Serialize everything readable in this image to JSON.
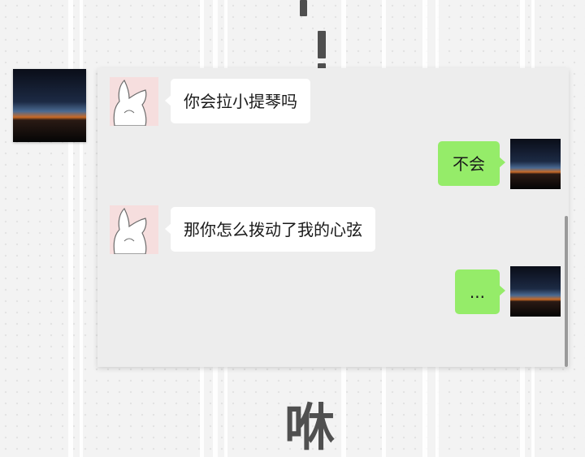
{
  "sound_effect": "咻",
  "messages": [
    {
      "side": "left",
      "text": "你会拉小提琴吗"
    },
    {
      "side": "right",
      "text": "不会"
    },
    {
      "side": "left",
      "text": "那你怎么拨动了我的心弦"
    },
    {
      "side": "right",
      "text": "..."
    }
  ],
  "colors": {
    "sent_bubble": "#95ec69",
    "received_bubble": "#ffffff",
    "chat_background": "#ededed"
  },
  "icons": {
    "contact_avatar": "bunny-sketch-icon",
    "user_avatar": "horizon-sky-icon"
  }
}
